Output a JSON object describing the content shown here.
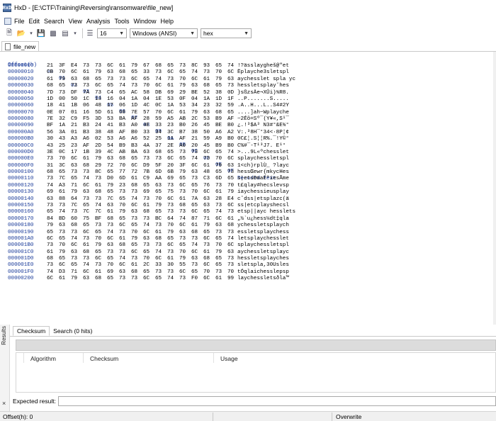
{
  "window": {
    "title": "HxD - [E:\\CTF\\Training\\Reversing\\ransomware\\file_new]",
    "app_icon": "HxD"
  },
  "menu": [
    "File",
    "Edit",
    "Search",
    "View",
    "Analysis",
    "Tools",
    "Window",
    "Help"
  ],
  "toolbar": {
    "bytes_per_row": "16",
    "charset": "Windows (ANSI)",
    "display": "hex"
  },
  "file_tab": "file_new",
  "hex": {
    "header": {
      "offset": "Offset(h)",
      "cols": [
        "00",
        "01",
        "02",
        "03",
        "04",
        "05",
        "06",
        "07",
        "08",
        "09",
        "0A",
        "0B",
        "0C",
        "0D",
        "0E",
        "0F"
      ],
      "decoded": "Decoded text"
    },
    "rows": [
      {
        "off": "00000000",
        "bytes": [
          "21",
          "3F",
          "E4",
          "73",
          "73",
          "6C",
          "61",
          "79",
          "67",
          "68",
          "65",
          "73",
          "8C",
          "93",
          "65",
          "74"
        ],
        "text": "!?ässlaygheš@\"et"
      },
      {
        "off": "00000010",
        "bytes": [
          "CB",
          "70",
          "6C",
          "61",
          "79",
          "63",
          "68",
          "65",
          "33",
          "73",
          "6C",
          "65",
          "74",
          "73",
          "70",
          "6C"
        ],
        "text": "Ëplayche3sletspl"
      },
      {
        "off": "00000020",
        "bytes": [
          "61",
          "79",
          "63",
          "68",
          "65",
          "73",
          "73",
          "6C",
          "65",
          "74",
          "73",
          "70",
          "6C",
          "61",
          "79",
          "63"
        ],
        "text": "aychesslet spla yc"
      },
      {
        "off": "00000030",
        "bytes": [
          "68",
          "65",
          "73",
          "73",
          "6C",
          "65",
          "74",
          "73",
          "70",
          "6C",
          "61",
          "79",
          "63",
          "68",
          "65",
          "73"
        ],
        "text": "hessletsplay˘hes"
      },
      {
        "off": "00000040",
        "bytes": [
          "7D",
          "73",
          "DF",
          "7A",
          "73",
          "C4",
          "65",
          "AC",
          "58",
          "DB",
          "69",
          "29",
          "BE",
          "52",
          "38",
          "0D"
        ],
        "text": "}sßzsÄe¬XÛi)¾R8."
      },
      {
        "off": "00000050",
        "bytes": [
          "1D",
          "00",
          "50",
          "1C",
          "13",
          "16",
          "04",
          "1A",
          "04",
          "1E",
          "53",
          "0F",
          "04",
          "1A",
          "1D",
          "1F"
        ],
        "text": "..P.......S....."
      },
      {
        "off": "00000060",
        "bytes": [
          "18",
          "41",
          "1B",
          "06",
          "48",
          "17",
          "06",
          "1D",
          "4C",
          "0C",
          "1A",
          "53",
          "34",
          "23",
          "32",
          "59"
        ],
        "text": ".A..H...L..S4#2Y"
      },
      {
        "off": "00000070",
        "bytes": [
          "0E",
          "07",
          "01",
          "16",
          "5D",
          "61",
          "68",
          "7E",
          "57",
          "70",
          "6C",
          "61",
          "79",
          "63",
          "68",
          "65"
        ],
        "text": "....]ah~Wplayche"
      },
      {
        "off": "00000080",
        "bytes": [
          "7E",
          "32",
          "C9",
          "F5",
          "3D",
          "53",
          "BA",
          "AF",
          "28",
          "59",
          "A5",
          "AB",
          "2C",
          "53",
          "B9",
          "AF"
        ],
        "text": "~2Éõ=Sº¯(Y¥«,S¹¯"
      },
      {
        "off": "00000090",
        "bytes": [
          "BF",
          "1A",
          "21",
          "B3",
          "24",
          "41",
          "B3",
          "A0",
          "4E",
          "33",
          "23",
          "B0",
          "26",
          "45",
          "BE",
          "B0"
        ],
        "text": "¿.!³$A³ N3#°&E¾°"
      },
      {
        "off": "000000A0",
        "bytes": [
          "56",
          "3A",
          "01",
          "B3",
          "38",
          "48",
          "AF",
          "B0",
          "33",
          "34",
          "3C",
          "B7",
          "38",
          "50",
          "A6",
          "A2"
        ],
        "text": "V:.³8H¯°34<·8P¦¢"
      },
      {
        "off": "000000B0",
        "bytes": [
          "30",
          "43",
          "A3",
          "A6",
          "02",
          "53",
          "A6",
          "A6",
          "52",
          "25",
          "11",
          "AF",
          "21",
          "59",
          "A9",
          "B0"
        ],
        "text": "0C£¦.S¦¦R%.¯!Y©°"
      },
      {
        "off": "000000C0",
        "bytes": [
          "43",
          "25",
          "23",
          "AF",
          "2D",
          "54",
          "B9",
          "B3",
          "4A",
          "37",
          "2E",
          "A0",
          "20",
          "45",
          "B9",
          "B0"
        ],
        "text": "C%#¯-T¹³J7. E¹°"
      },
      {
        "off": "000000D0",
        "bytes": [
          "3E",
          "0C",
          "17",
          "1B",
          "39",
          "4C",
          "AB",
          "BA",
          "63",
          "68",
          "65",
          "73",
          "73",
          "6C",
          "65",
          "74"
        ],
        "text": ">...9L«ºchesslet"
      },
      {
        "off": "000000E0",
        "bytes": [
          "73",
          "70",
          "6C",
          "61",
          "79",
          "63",
          "68",
          "65",
          "73",
          "73",
          "6C",
          "65",
          "74",
          "73",
          "70",
          "6C"
        ],
        "text": "splaychessletspl"
      },
      {
        "off": "000000F0",
        "bytes": [
          "31",
          "3C",
          "63",
          "68",
          "29",
          "72",
          "70",
          "6C",
          "D9",
          "5F",
          "20",
          "3F",
          "6C",
          "61",
          "79",
          "63"
        ],
        "text": "1<ch)rplÙ_ ?layc"
      },
      {
        "off": "00000100",
        "bytes": [
          "68",
          "65",
          "73",
          "73",
          "8C",
          "65",
          "77",
          "72",
          "7B",
          "6D",
          "6B",
          "79",
          "63",
          "48",
          "65",
          "73"
        ],
        "text": "hessŒewr{mkycHes"
      },
      {
        "off": "00000110",
        "bytes": [
          "73",
          "7C",
          "65",
          "74",
          "73",
          "D0",
          "6D",
          "61",
          "C9",
          "AA",
          "69",
          "65",
          "73",
          "C3",
          "6D",
          "65"
        ],
        "text": "s|etsÐmaÉªiesÃme"
      },
      {
        "off": "00000120",
        "bytes": [
          "74",
          "A3",
          "71",
          "6C",
          "61",
          "79",
          "23",
          "68",
          "65",
          "63",
          "73",
          "6C",
          "65",
          "76",
          "73",
          "70"
        ],
        "text": "t£qlay#hecslevsp"
      },
      {
        "off": "00000130",
        "bytes": [
          "69",
          "61",
          "79",
          "63",
          "68",
          "65",
          "73",
          "73",
          "69",
          "65",
          "75",
          "73",
          "70",
          "6C",
          "61",
          "79"
        ],
        "text": "iaychessieusplay"
      },
      {
        "off": "00000140",
        "bytes": [
          "63",
          "88",
          "64",
          "73",
          "73",
          "7C",
          "65",
          "74",
          "73",
          "70",
          "6C",
          "61",
          "7A",
          "63",
          "28",
          "E4"
        ],
        "text": "cˆdss|etsplazc(ä"
      },
      {
        "off": "00000150",
        "bytes": [
          "73",
          "73",
          "7C",
          "65",
          "74",
          "63",
          "70",
          "6C",
          "61",
          "79",
          "73",
          "68",
          "65",
          "63",
          "73",
          "6C"
        ],
        "text": "ss|etcplayshecsl"
      },
      {
        "off": "00000160",
        "bytes": [
          "65",
          "74",
          "73",
          "7C",
          "7C",
          "61",
          "79",
          "63",
          "68",
          "65",
          "73",
          "73",
          "6C",
          "65",
          "74",
          "73"
        ],
        "text": "etsp||ayc hesslets"
      },
      {
        "off": "00000170",
        "bytes": [
          "84",
          "BD",
          "60",
          "75",
          "BF",
          "68",
          "65",
          "73",
          "73",
          "BC",
          "64",
          "74",
          "87",
          "71",
          "6C",
          "61"
        ],
        "text": "„½`u¿hess¼dt‡qla"
      },
      {
        "off": "00000180",
        "bytes": [
          "79",
          "63",
          "68",
          "65",
          "73",
          "73",
          "6C",
          "65",
          "74",
          "73",
          "70",
          "6C",
          "61",
          "79",
          "63",
          "68"
        ],
        "text": "ychessletsplaych"
      },
      {
        "off": "00000190",
        "bytes": [
          "65",
          "73",
          "73",
          "6C",
          "65",
          "74",
          "73",
          "70",
          "6C",
          "61",
          "79",
          "63",
          "68",
          "65",
          "73",
          "73"
        ],
        "text": "essletsplaychess"
      },
      {
        "off": "000001A0",
        "bytes": [
          "6C",
          "65",
          "74",
          "73",
          "70",
          "6C",
          "61",
          "79",
          "63",
          "68",
          "65",
          "73",
          "73",
          "6C",
          "65",
          "74"
        ],
        "text": "letsplaychesslet"
      },
      {
        "off": "000001B0",
        "bytes": [
          "73",
          "70",
          "6C",
          "61",
          "79",
          "63",
          "68",
          "65",
          "73",
          "73",
          "6C",
          "65",
          "74",
          "73",
          "70",
          "6C"
        ],
        "text": "splaychessletspl"
      },
      {
        "off": "000001C0",
        "bytes": [
          "61",
          "79",
          "63",
          "68",
          "65",
          "73",
          "73",
          "6C",
          "65",
          "74",
          "73",
          "70",
          "6C",
          "61",
          "79",
          "63"
        ],
        "text": "aychessletsplayc"
      },
      {
        "off": "000001D0",
        "bytes": [
          "68",
          "65",
          "73",
          "73",
          "6C",
          "65",
          "74",
          "73",
          "70",
          "6C",
          "61",
          "79",
          "63",
          "68",
          "65",
          "73"
        ],
        "text": "hessletsplayches"
      },
      {
        "off": "000001E0",
        "bytes": [
          "73",
          "6C",
          "65",
          "74",
          "73",
          "70",
          "6C",
          "61",
          "2C",
          "33",
          "30",
          "55",
          "73",
          "6C",
          "65",
          "73"
        ],
        "text": "sletspla,30Usles"
      },
      {
        "off": "000001F0",
        "bytes": [
          "74",
          "D3",
          "71",
          "6C",
          "61",
          "69",
          "63",
          "68",
          "65",
          "73",
          "73",
          "6C",
          "65",
          "70",
          "73",
          "70"
        ],
        "text": "tÓqlaichesslepsp"
      },
      {
        "off": "00000200",
        "bytes": [
          "6C",
          "61",
          "79",
          "63",
          "68",
          "65",
          "73",
          "73",
          "6C",
          "65",
          "74",
          "73",
          "F0",
          "6C",
          "61",
          "99"
        ],
        "text": "laychessletsðla™"
      }
    ]
  },
  "results": {
    "side_label": "Results",
    "tabs": [
      "Checksum",
      "Search (0 hits)"
    ],
    "columns": [
      "Algorithm",
      "Checksum",
      "Usage"
    ],
    "expected_label": "Expected result:"
  },
  "status": {
    "offset": "Offset(h): 0",
    "mode": "Overwrite"
  }
}
